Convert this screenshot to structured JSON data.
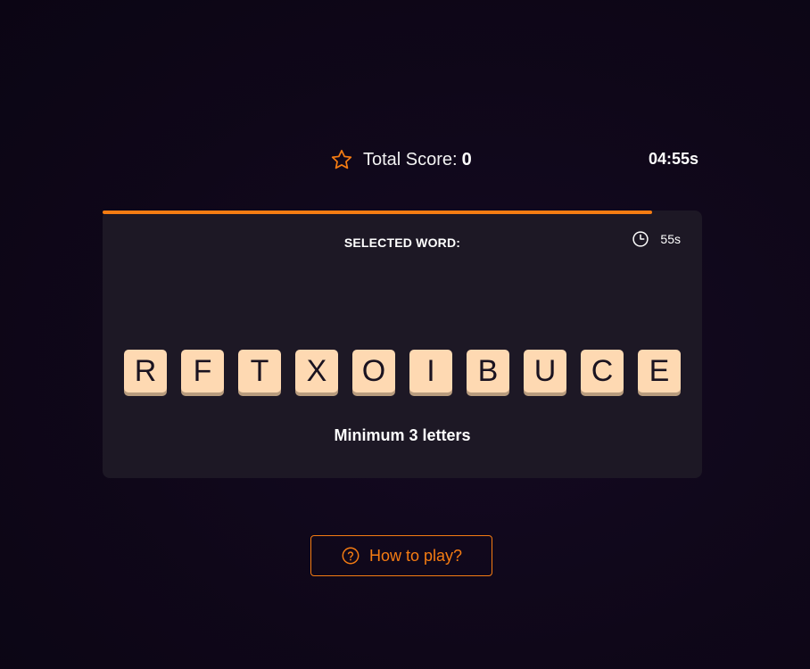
{
  "header": {
    "score_icon": "star-icon",
    "score_label": "Total Score:",
    "score_value": "0",
    "total_time": "04:55s"
  },
  "round": {
    "progress_fraction": 0.917,
    "selected_word_label": "SELECTED WORD:",
    "selected_word": "",
    "timer_icon": "clock-icon",
    "time_left": "55s",
    "tiles": [
      "R",
      "F",
      "T",
      "X",
      "O",
      "I",
      "B",
      "U",
      "C",
      "E"
    ],
    "hint": "Minimum 3 letters"
  },
  "help": {
    "icon": "question-circle-icon",
    "label": "How to play?"
  },
  "colors": {
    "accent": "#f57c12",
    "panel": "#1d1825",
    "tile": "#fed9b2",
    "tile_shadow": "#b89c7e",
    "background": "#0f0719"
  }
}
